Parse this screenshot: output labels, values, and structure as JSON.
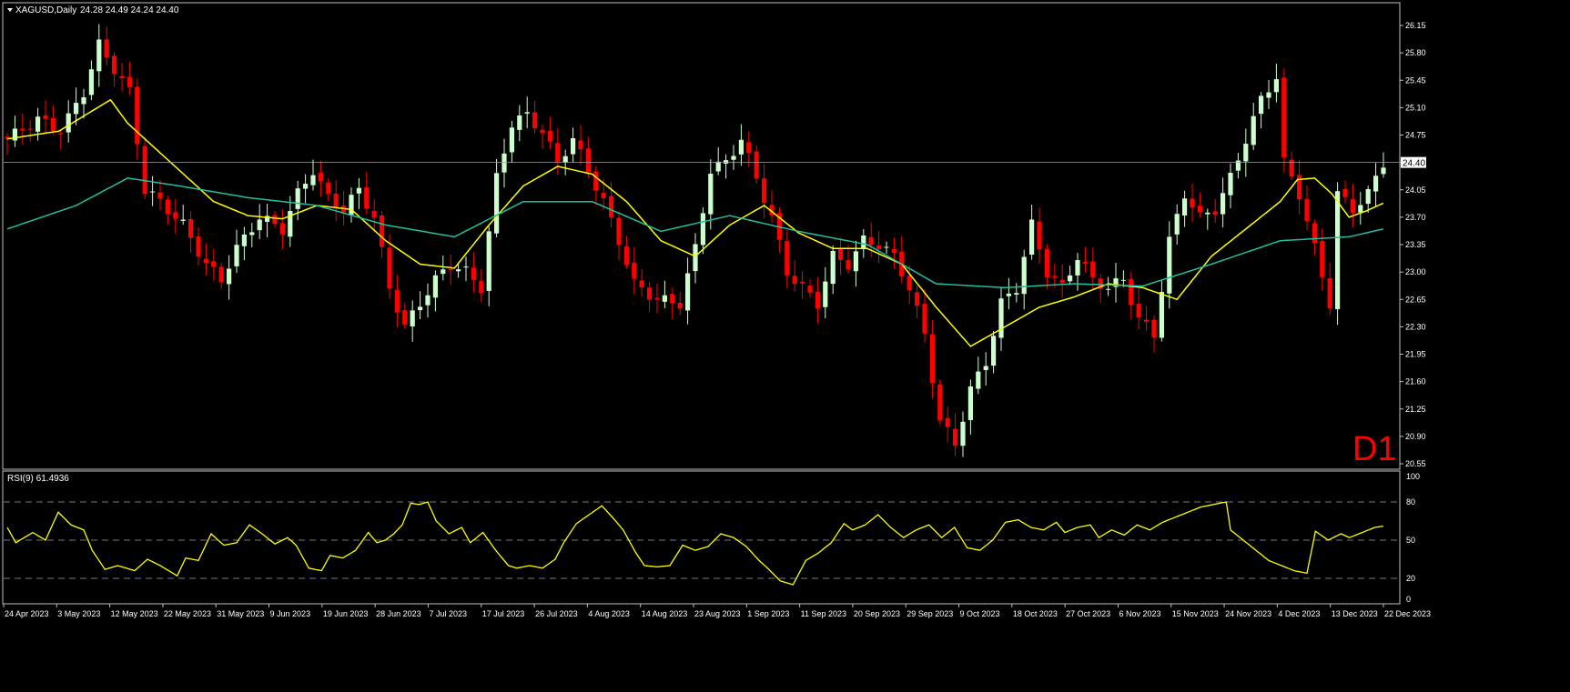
{
  "header": {
    "symbol_label": "XAGUSD,Daily",
    "ohlc_label": "24.28 24.49 24.24 24.40",
    "timeframe_badge": "D1"
  },
  "colors": {
    "background": "#000000",
    "frame": "#c0c0c0",
    "bull_candle": "#ccffcc",
    "bear_candle": "#ff0000",
    "ma_fast": "#ffff00",
    "ma_slow": "#20c0a0",
    "rsi_line": "#ffff00",
    "current_price_line": "#a0a0a0",
    "badge": "#ff0000",
    "text": "#ffffff"
  },
  "chart_data": [
    {
      "type": "candlestick",
      "name": "XAGUSD,Daily",
      "ylim": [
        20.55,
        26.15
      ],
      "y_ticks": [
        "26.15",
        "25.80",
        "25.45",
        "25.10",
        "24.75",
        "24.40",
        "24.05",
        "23.70",
        "23.35",
        "23.00",
        "22.65",
        "22.30",
        "21.95",
        "21.60",
        "21.25",
        "20.90",
        "20.55"
      ],
      "x_tick_labels": [
        "24 Apr 2023",
        "3 May 2023",
        "12 May 2023",
        "22 May 2023",
        "31 May 2023",
        "9 Jun 2023",
        "19 Jun 2023",
        "28 Jun 2023",
        "7 Jul 2023",
        "17 Jul 2023",
        "26 Jul 2023",
        "4 Aug 2023",
        "14 Aug 2023",
        "23 Aug 2023",
        "1 Sep 2023",
        "11 Sep 2023",
        "20 Sep 2023",
        "29 Sep 2023",
        "9 Oct 2023",
        "18 Oct 2023",
        "27 Oct 2023",
        "6 Nov 2023",
        "15 Nov 2023",
        "24 Nov 2023",
        "4 Dec 2023",
        "13 Dec 2023",
        "22 Dec 2023"
      ],
      "current_price": 24.4,
      "current_price_label": "24.40",
      "close_anchors": [
        [
          0,
          24.7
        ],
        [
          4,
          24.95
        ],
        [
          7,
          24.8
        ],
        [
          10,
          25.3
        ],
        [
          12,
          25.9
        ],
        [
          14,
          25.6
        ],
        [
          16,
          25.3
        ],
        [
          18,
          24.05
        ],
        [
          20,
          23.9
        ],
        [
          23,
          23.6
        ],
        [
          26,
          23.1
        ],
        [
          28,
          22.9
        ],
        [
          30,
          23.3
        ],
        [
          33,
          23.7
        ],
        [
          36,
          23.55
        ],
        [
          38,
          24.0
        ],
        [
          40,
          24.3
        ],
        [
          42,
          23.95
        ],
        [
          44,
          23.8
        ],
        [
          46,
          24.05
        ],
        [
          48,
          23.7
        ],
        [
          50,
          22.8
        ],
        [
          52,
          22.3
        ],
        [
          54,
          22.6
        ],
        [
          56,
          22.9
        ],
        [
          58,
          23.1
        ],
        [
          60,
          23.0
        ],
        [
          62,
          22.8
        ],
        [
          64,
          24.2
        ],
        [
          66,
          24.9
        ],
        [
          68,
          25.0
        ],
        [
          70,
          24.8
        ],
        [
          72,
          24.4
        ],
        [
          74,
          24.7
        ],
        [
          76,
          24.3
        ],
        [
          78,
          23.9
        ],
        [
          80,
          23.4
        ],
        [
          82,
          22.85
        ],
        [
          85,
          22.65
        ],
        [
          88,
          22.6
        ],
        [
          90,
          23.3
        ],
        [
          92,
          24.3
        ],
        [
          94,
          24.4
        ],
        [
          96,
          24.7
        ],
        [
          98,
          24.2
        ],
        [
          100,
          23.7
        ],
        [
          102,
          23.0
        ],
        [
          104,
          22.8
        ],
        [
          106,
          22.6
        ],
        [
          108,
          23.2
        ],
        [
          110,
          23.1
        ],
        [
          112,
          23.4
        ],
        [
          114,
          23.35
        ],
        [
          116,
          23.2
        ],
        [
          118,
          22.8
        ],
        [
          120,
          22.2
        ],
        [
          122,
          21.1
        ],
        [
          124,
          20.8
        ],
        [
          126,
          21.5
        ],
        [
          128,
          21.85
        ],
        [
          130,
          22.6
        ],
        [
          132,
          22.8
        ],
        [
          134,
          23.6
        ],
        [
          136,
          23.0
        ],
        [
          138,
          22.8
        ],
        [
          140,
          23.2
        ],
        [
          142,
          22.9
        ],
        [
          144,
          22.8
        ],
        [
          146,
          22.9
        ],
        [
          148,
          22.4
        ],
        [
          150,
          22.2
        ],
        [
          152,
          23.4
        ],
        [
          154,
          24.0
        ],
        [
          156,
          23.7
        ],
        [
          158,
          23.8
        ],
        [
          160,
          24.2
        ],
        [
          162,
          24.7
        ],
        [
          164,
          25.2
        ],
        [
          166,
          25.5
        ],
        [
          167,
          24.4
        ],
        [
          169,
          24.0
        ],
        [
          171,
          23.3
        ],
        [
          173,
          22.6
        ],
        [
          174,
          24.0
        ],
        [
          176,
          23.8
        ],
        [
          178,
          24.0
        ],
        [
          180,
          24.4
        ]
      ],
      "series": [
        {
          "name": "",
          "kind": "moving-average-fast",
          "anchors": [
            [
              0,
              24.7
            ],
            [
              6,
              24.8
            ],
            [
              12,
              25.2
            ],
            [
              14,
              24.9
            ],
            [
              18,
              24.5
            ],
            [
              24,
              23.9
            ],
            [
              28,
              23.72
            ],
            [
              32,
              23.68
            ],
            [
              36,
              23.85
            ],
            [
              40,
              23.8
            ],
            [
              44,
              23.4
            ],
            [
              48,
              23.1
            ],
            [
              52,
              23.05
            ],
            [
              56,
              23.6
            ],
            [
              60,
              24.1
            ],
            [
              64,
              24.35
            ],
            [
              68,
              24.25
            ],
            [
              72,
              23.9
            ],
            [
              76,
              23.4
            ],
            [
              80,
              23.2
            ],
            [
              84,
              23.6
            ],
            [
              88,
              23.85
            ],
            [
              92,
              23.5
            ],
            [
              96,
              23.3
            ],
            [
              100,
              23.3
            ],
            [
              104,
              23.1
            ],
            [
              108,
              22.55
            ],
            [
              112,
              22.05
            ],
            [
              116,
              22.3
            ],
            [
              120,
              22.55
            ],
            [
              124,
              22.68
            ],
            [
              128,
              22.85
            ],
            [
              132,
              22.8
            ],
            [
              136,
              22.65
            ],
            [
              140,
              23.2
            ],
            [
              144,
              23.55
            ],
            [
              148,
              23.9
            ],
            [
              150,
              24.18
            ],
            [
              152,
              24.2
            ],
            [
              154,
              24.0
            ],
            [
              156,
              23.7
            ],
            [
              158,
              23.78
            ],
            [
              160,
              23.88
            ]
          ]
        },
        {
          "name": "",
          "kind": "moving-average-slow",
          "anchors": [
            [
              0,
              23.55
            ],
            [
              8,
              23.85
            ],
            [
              14,
              24.2
            ],
            [
              20,
              24.1
            ],
            [
              28,
              23.95
            ],
            [
              36,
              23.85
            ],
            [
              44,
              23.6
            ],
            [
              52,
              23.45
            ],
            [
              60,
              23.9
            ],
            [
              68,
              23.9
            ],
            [
              76,
              23.52
            ],
            [
              84,
              23.72
            ],
            [
              92,
              23.52
            ],
            [
              100,
              23.35
            ],
            [
              108,
              22.85
            ],
            [
              116,
              22.8
            ],
            [
              124,
              22.85
            ],
            [
              132,
              22.82
            ],
            [
              140,
              23.1
            ],
            [
              148,
              23.4
            ],
            [
              156,
              23.45
            ],
            [
              160,
              23.55
            ]
          ]
        }
      ]
    },
    {
      "type": "line",
      "name": "RSI(9) 61.4936",
      "ylim": [
        0,
        100
      ],
      "y_ticks": [
        "100",
        "80",
        "50",
        "20",
        "0"
      ],
      "levels": [
        80,
        50,
        20
      ],
      "series": [
        {
          "name": "RSI(9)",
          "anchors": [
            [
              0,
              60
            ],
            [
              2,
              48
            ],
            [
              6,
              56
            ],
            [
              9,
              50
            ],
            [
              12,
              72
            ],
            [
              15,
              62
            ],
            [
              18,
              58
            ],
            [
              20,
              42
            ],
            [
              23,
              27
            ],
            [
              26,
              30
            ],
            [
              30,
              26
            ],
            [
              33,
              35
            ],
            [
              36,
              30
            ],
            [
              40,
              22
            ],
            [
              42,
              36
            ],
            [
              45,
              34
            ],
            [
              48,
              55
            ],
            [
              51,
              46
            ],
            [
              54,
              48
            ],
            [
              57,
              62
            ],
            [
              60,
              55
            ],
            [
              63,
              47
            ],
            [
              66,
              52
            ],
            [
              68,
              46
            ],
            [
              71,
              28
            ],
            [
              74,
              26
            ],
            [
              76,
              38
            ],
            [
              79,
              36
            ],
            [
              82,
              42
            ],
            [
              85,
              56
            ],
            [
              87,
              48
            ],
            [
              89,
              50
            ],
            [
              91,
              55
            ],
            [
              93,
              62
            ],
            [
              95,
              79
            ],
            [
              97,
              78
            ],
            [
              99,
              80
            ],
            [
              101,
              65
            ],
            [
              104,
              55
            ],
            [
              107,
              60
            ],
            [
              109,
              48
            ],
            [
              112,
              56
            ],
            [
              115,
              42
            ],
            [
              118,
              30
            ],
            [
              120,
              28
            ],
            [
              123,
              30
            ],
            [
              126,
              28
            ],
            [
              129,
              35
            ],
            [
              131,
              48
            ],
            [
              134,
              63
            ],
            [
              137,
              70
            ],
            [
              140,
              77
            ],
            [
              143,
              66
            ],
            [
              145,
              58
            ],
            [
              148,
              40
            ],
            [
              150,
              30
            ],
            [
              153,
              29
            ],
            [
              156,
              30
            ],
            [
              159,
              46
            ],
            [
              162,
              42
            ],
            [
              165,
              45
            ],
            [
              168,
              55
            ],
            [
              171,
              52
            ],
            [
              174,
              45
            ],
            [
              177,
              34
            ],
            [
              179,
              28
            ],
            [
              182,
              18
            ],
            [
              185,
              15
            ],
            [
              188,
              34
            ],
            [
              191,
              40
            ],
            [
              194,
              48
            ],
            [
              197,
              63
            ],
            [
              199,
              58
            ],
            [
              202,
              62
            ],
            [
              205,
              70
            ],
            [
              208,
              60
            ],
            [
              211,
              52
            ],
            [
              214,
              58
            ],
            [
              217,
              62
            ],
            [
              220,
              52
            ],
            [
              223,
              60
            ],
            [
              226,
              44
            ],
            [
              229,
              42
            ],
            [
              232,
              50
            ],
            [
              235,
              64
            ],
            [
              238,
              66
            ],
            [
              241,
              60
            ],
            [
              244,
              58
            ],
            [
              247,
              64
            ],
            [
              249,
              56
            ],
            [
              252,
              60
            ],
            [
              255,
              62
            ],
            [
              257,
              52
            ],
            [
              260,
              58
            ],
            [
              263,
              54
            ],
            [
              266,
              62
            ],
            [
              269,
              58
            ],
            [
              272,
              64
            ],
            [
              275,
              68
            ],
            [
              278,
              72
            ],
            [
              281,
              76
            ],
            [
              284,
              78
            ],
            [
              287,
              80
            ],
            [
              288,
              58
            ],
            [
              291,
              50
            ],
            [
              294,
              42
            ],
            [
              297,
              34
            ],
            [
              300,
              30
            ],
            [
              303,
              26
            ],
            [
              306,
              24
            ],
            [
              308,
              57
            ],
            [
              311,
              50
            ],
            [
              314,
              55
            ],
            [
              316,
              52
            ],
            [
              319,
              56
            ],
            [
              322,
              60
            ],
            [
              324,
              61
            ]
          ]
        }
      ]
    }
  ]
}
